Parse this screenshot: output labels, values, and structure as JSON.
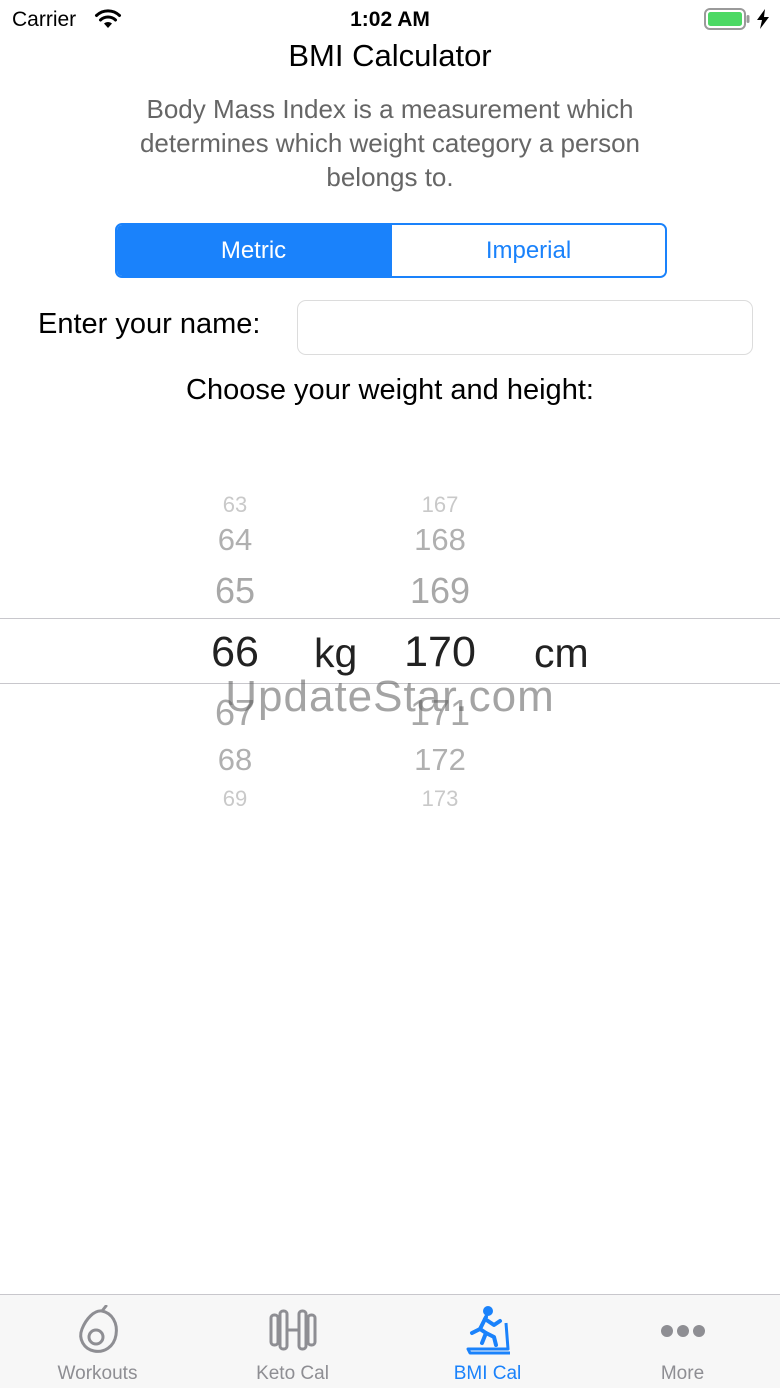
{
  "status_bar": {
    "carrier": "Carrier",
    "time": "1:02 AM"
  },
  "header": {
    "title": "BMI Calculator",
    "description": "Body Mass Index is a measurement which determines which weight category a person belongs to."
  },
  "units_toggle": {
    "options": [
      "Metric",
      "Imperial"
    ],
    "selected": "Metric"
  },
  "name_field": {
    "label": "Enter your name:",
    "value": "",
    "placeholder": ""
  },
  "picker": {
    "prompt": "Choose your weight and height:",
    "weight_values": [
      "63",
      "64",
      "65",
      "66",
      "67",
      "68",
      "69"
    ],
    "weight_selected": "66",
    "weight_unit": "kg",
    "height_values": [
      "167",
      "168",
      "169",
      "170",
      "171",
      "172",
      "173"
    ],
    "height_selected": "170",
    "height_unit": "cm"
  },
  "watermark": "UpdateStar.com",
  "tab_bar": {
    "tabs": [
      {
        "label": "Workouts",
        "icon": "avocado-icon",
        "active": false
      },
      {
        "label": "Keto Cal",
        "icon": "dumbbell-icon",
        "active": false
      },
      {
        "label": "BMI Cal",
        "icon": "treadmill-icon",
        "active": true
      },
      {
        "label": "More",
        "icon": "more-dots-icon",
        "active": false
      }
    ]
  },
  "colors": {
    "accent": "#1a82fb",
    "inactive_tab": "#8e8e93",
    "picker_faded": "#b3b3b3"
  }
}
